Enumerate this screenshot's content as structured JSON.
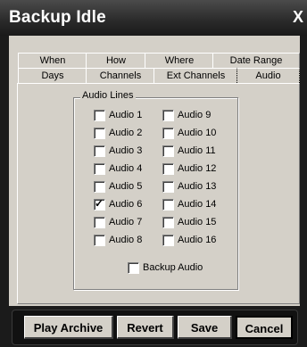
{
  "window": {
    "title": "Backup Idle",
    "close": "X"
  },
  "tabs": {
    "row1": [
      "When",
      "How",
      "Where",
      "Date Range"
    ],
    "row2": [
      "Days",
      "Channels",
      "Ext Channels",
      "Audio"
    ],
    "active": "Audio"
  },
  "audio_lines": {
    "group_label": "Audio Lines",
    "items": [
      {
        "label": "Audio 1",
        "checked": false
      },
      {
        "label": "Audio 2",
        "checked": false
      },
      {
        "label": "Audio 3",
        "checked": false
      },
      {
        "label": "Audio 4",
        "checked": false
      },
      {
        "label": "Audio 5",
        "checked": false
      },
      {
        "label": "Audio 6",
        "checked": true
      },
      {
        "label": "Audio 7",
        "checked": false
      },
      {
        "label": "Audio 8",
        "checked": false
      },
      {
        "label": "Audio 9",
        "checked": false
      },
      {
        "label": "Audio 10",
        "checked": false
      },
      {
        "label": "Audio 11",
        "checked": false
      },
      {
        "label": "Audio 12",
        "checked": false
      },
      {
        "label": "Audio 13",
        "checked": false
      },
      {
        "label": "Audio 14",
        "checked": false
      },
      {
        "label": "Audio 15",
        "checked": false
      },
      {
        "label": "Audio 16",
        "checked": false
      }
    ],
    "backup_audio": {
      "label": "Backup Audio",
      "checked": false
    }
  },
  "buttons": {
    "play_archive": "Play Archive",
    "revert": "Revert",
    "save": "Save",
    "cancel": "Cancel"
  },
  "check_glyph": "✓"
}
